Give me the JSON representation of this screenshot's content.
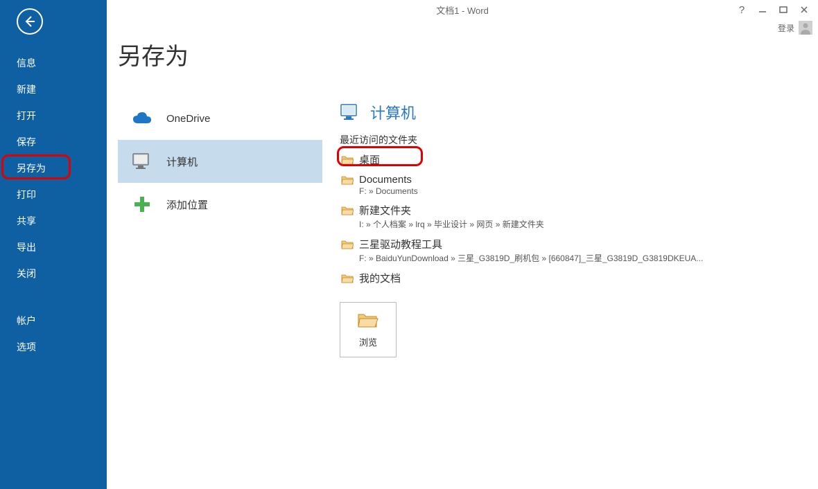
{
  "window": {
    "title": "文档1 - Word",
    "help_label": "?",
    "sign_in": "登录"
  },
  "sidebar": {
    "items": [
      "信息",
      "新建",
      "打开",
      "保存",
      "另存为",
      "打印",
      "共享",
      "导出",
      "关闭"
    ],
    "lower": [
      "帐户",
      "选项"
    ],
    "active_index": 4
  },
  "page": {
    "title": "另存为"
  },
  "places": [
    {
      "label": "OneDrive",
      "icon": "cloud"
    },
    {
      "label": "计算机",
      "icon": "computer",
      "selected": true
    },
    {
      "label": "添加位置",
      "icon": "plus"
    }
  ],
  "pane": {
    "heading": "计算机",
    "section_label": "最近访问的文件夹",
    "folders": [
      {
        "name": "桌面",
        "highlighted": true
      },
      {
        "name": "Documents",
        "path": "F: » Documents"
      },
      {
        "name": "新建文件夹",
        "path": "I: » 个人档案 » lrq » 毕业设计 » 网页 » 新建文件夹"
      },
      {
        "name": "三星驱动教程工具",
        "path": "F: » BaiduYunDownload » 三星_G3819D_刷机包 » [660847]_三星_G3819D_G3819DKEUA..."
      },
      {
        "name": "我的文档"
      }
    ],
    "browse_label": "浏览"
  }
}
